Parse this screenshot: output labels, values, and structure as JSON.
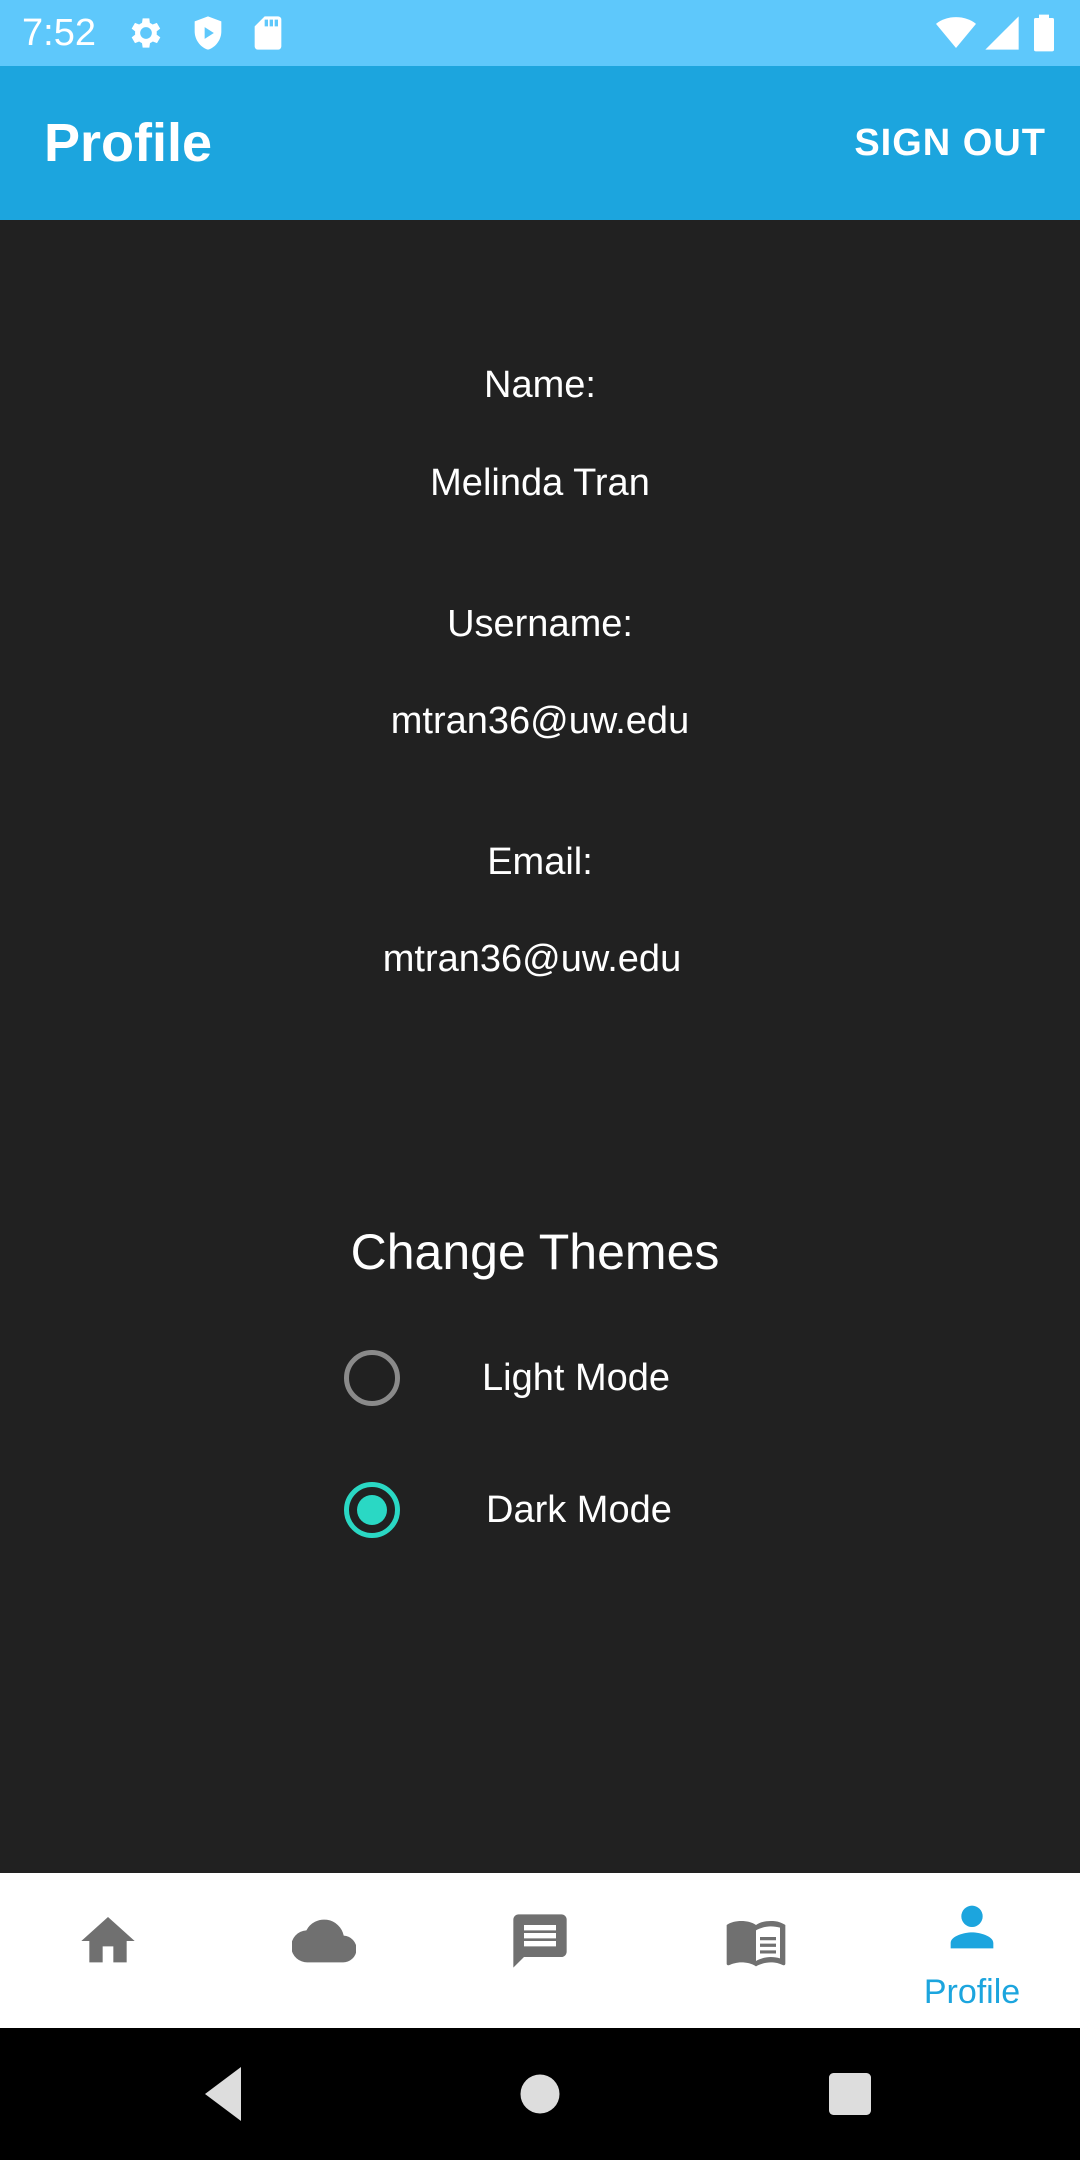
{
  "status_bar": {
    "time": "7:52",
    "icons": [
      "gear-icon",
      "shield-icon",
      "sd-card-icon",
      "wifi-icon",
      "signal-icon",
      "battery-icon"
    ]
  },
  "app_bar": {
    "title": "Profile",
    "action_label": "SIGN OUT",
    "color": "#1ca5de"
  },
  "profile": {
    "name_label": "Name:",
    "name_value": "Melinda Tran",
    "username_label": "Username:",
    "username_value": "mtran36@uw.edu",
    "email_label": "Email:",
    "email_value": "mtran36@uw.edu"
  },
  "themes": {
    "title": "Change Themes",
    "options": [
      {
        "label": "Light Mode",
        "selected": false
      },
      {
        "label": "Dark Mode",
        "selected": true
      }
    ],
    "accent_color": "#2ad8c4"
  },
  "bottom_nav": {
    "items": [
      {
        "icon": "home-icon",
        "label": ""
      },
      {
        "icon": "cloud-icon",
        "label": ""
      },
      {
        "icon": "chat-icon",
        "label": ""
      },
      {
        "icon": "book-icon",
        "label": ""
      },
      {
        "icon": "person-icon",
        "label": "Profile",
        "active": true
      }
    ]
  },
  "system_nav": {
    "icons": [
      "back-icon",
      "home-circle-icon",
      "recents-icon"
    ]
  }
}
